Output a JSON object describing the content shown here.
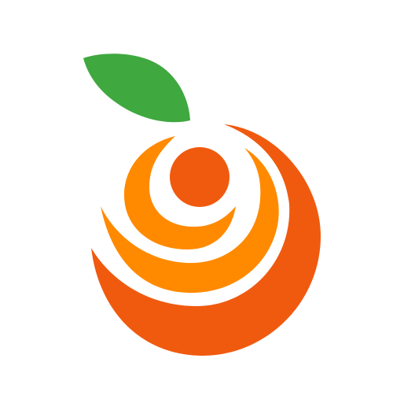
{
  "logo": {
    "icon": "orange-fruit-logo-icon",
    "colors": {
      "background": "#ffffff",
      "leaf": "#3fa83f",
      "outer_peel": "#f05a0f",
      "middle_ring": "#ff8a00",
      "inner_ring": "#ff8a00",
      "core": "#f05a0f"
    }
  }
}
